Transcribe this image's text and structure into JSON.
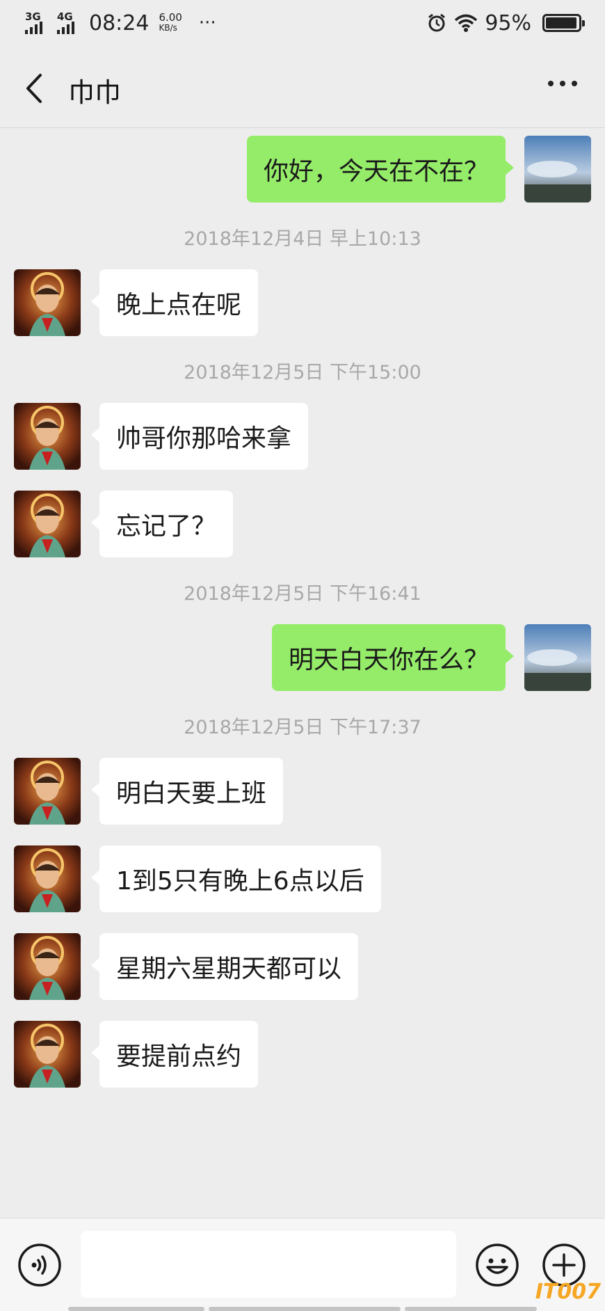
{
  "status_bar": {
    "net1": "3G",
    "net2": "4G",
    "time": "08:24",
    "speed_value": "6.00",
    "speed_unit": "KB/s",
    "dots": "···",
    "battery": "95%",
    "battery_level": 0.95
  },
  "header": {
    "title": "巾巾"
  },
  "messages": [
    {
      "type": "out",
      "text": "你好，今天在不在？"
    },
    {
      "type": "time",
      "text": "2018年12月4日 早上10:13"
    },
    {
      "type": "in",
      "text": "晚上点在呢"
    },
    {
      "type": "time",
      "text": "2018年12月5日 下午15:00"
    },
    {
      "type": "in",
      "text": "帅哥你那哈来拿"
    },
    {
      "type": "in",
      "text": "忘记了？"
    },
    {
      "type": "time",
      "text": "2018年12月5日 下午16:41"
    },
    {
      "type": "out",
      "text": "明天白天你在么？"
    },
    {
      "type": "time",
      "text": "2018年12月5日 下午17:37"
    },
    {
      "type": "in",
      "text": "明白天要上班"
    },
    {
      "type": "in",
      "text": "1到5只有晚上6点以后"
    },
    {
      "type": "in",
      "text": "星期六星期天都可以"
    },
    {
      "type": "in",
      "text": "要提前点约"
    }
  ],
  "input": {
    "value": "",
    "placeholder": ""
  },
  "watermark": "IT007",
  "colors": {
    "background": "#ededed",
    "outgoing_bubble": "#95ec69",
    "incoming_bubble": "#ffffff",
    "timestamp": "#a8a8a8"
  },
  "icons": {
    "back": "chevron-left-icon",
    "more": "more-dots-icon",
    "voice": "voice-icon",
    "emoji": "emoji-icon",
    "plus": "plus-icon"
  }
}
